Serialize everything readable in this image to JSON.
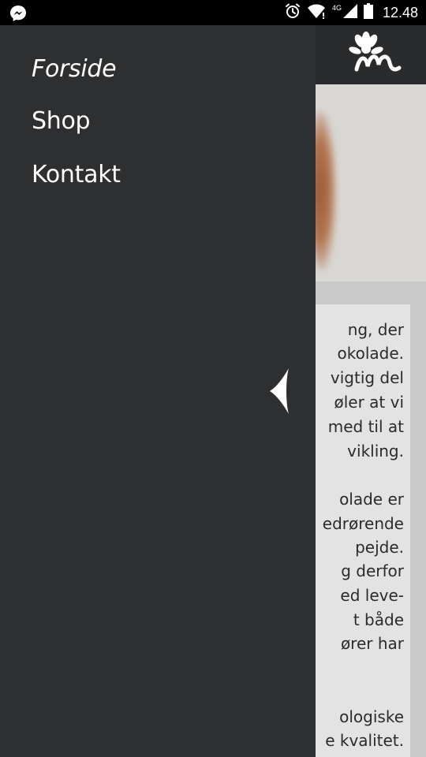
{
  "status_bar": {
    "time": "12.48",
    "network": "4G",
    "icons": [
      "messenger-icon",
      "alarm-icon",
      "wifi-icon",
      "signal-icon",
      "battery-icon"
    ]
  },
  "drawer": {
    "menu": [
      {
        "label": "Forside",
        "active": true
      },
      {
        "label": "Shop",
        "active": false
      },
      {
        "label": "Kontakt",
        "active": false
      }
    ],
    "close_icon": "chevron-left-icon"
  },
  "background": {
    "logo_icon": "flower-m-logo-icon",
    "visible_text_fragments": [
      "ng, der",
      "okolade.",
      "vigtig del",
      "øler at vi",
      "med til at",
      "vikling.",
      "",
      "olade er",
      "edrørende",
      "pejde.",
      "g derfor",
      "ed leve-",
      "t både",
      "ører har",
      "",
      "ologiske",
      "e kvalitet."
    ]
  },
  "colors": {
    "drawer_bg": "#2e2f31",
    "header_bg": "#2a2b2d",
    "text_on_dark": "#ffffff",
    "page_bg": "#c9c9c9"
  }
}
